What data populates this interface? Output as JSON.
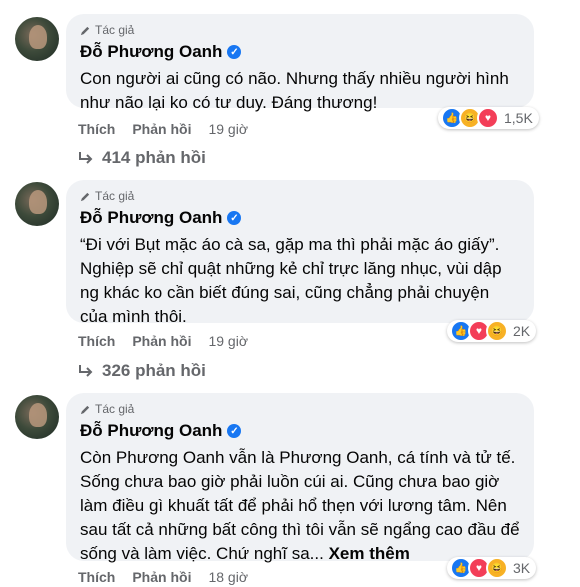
{
  "colors": {
    "accent": "#1877f2",
    "bubble": "#f0f2f5",
    "secondary_text": "#65676b"
  },
  "comments": [
    {
      "badge": "Tác giả",
      "author": "Đỗ Phương Oanh",
      "text": "Con người ai cũng có não. Nhưng thấy nhiều người hình như não lại ko có tư duy. Đáng thương!",
      "see_more": "",
      "like_label": "Thích",
      "reply_label": "Phản hồi",
      "time": "19 giờ",
      "reaction_count": "1,5K",
      "reactions": [
        "like-icon",
        "haha-icon",
        "love-icon"
      ],
      "replies": "414 phản hồi"
    },
    {
      "badge": "Tác giả",
      "author": "Đỗ Phương Oanh",
      "text": "“Đi với Bụt mặc áo cà sa, gặp ma thì phải mặc áo giấy”. Nghiệp sẽ chỉ quật những kẻ chỉ trực lăng nhục, vùi dập ng khác ko cần biết đúng sai, cũng chẳng phải chuyện của mình thôi.",
      "see_more": "",
      "like_label": "Thích",
      "reply_label": "Phản hồi",
      "time": "19 giờ",
      "reaction_count": "2K",
      "reactions": [
        "like-icon",
        "love-icon",
        "haha-icon"
      ],
      "replies": "326 phản hồi"
    },
    {
      "badge": "Tác giả",
      "author": "Đỗ Phương Oanh",
      "text": "Còn Phương Oanh vẫn là Phương Oanh, cá tính và tử tế. Sống chưa bao giờ phải luồn cúi ai. Cũng chưa bao giờ làm điều gì khuất tất để phải hổ thẹn với lương tâm. Nên sau tất cả những bất công thì tôi vẫn sẽ ngẩng cao đầu để sống và làm việc. Chứ nghĩ sa...",
      "see_more": "Xem thêm",
      "like_label": "Thích",
      "reply_label": "Phản hồi",
      "time": "18 giờ",
      "reaction_count": "3K",
      "reactions": [
        "like-icon",
        "love-icon",
        "haha-icon"
      ],
      "replies": ""
    }
  ]
}
